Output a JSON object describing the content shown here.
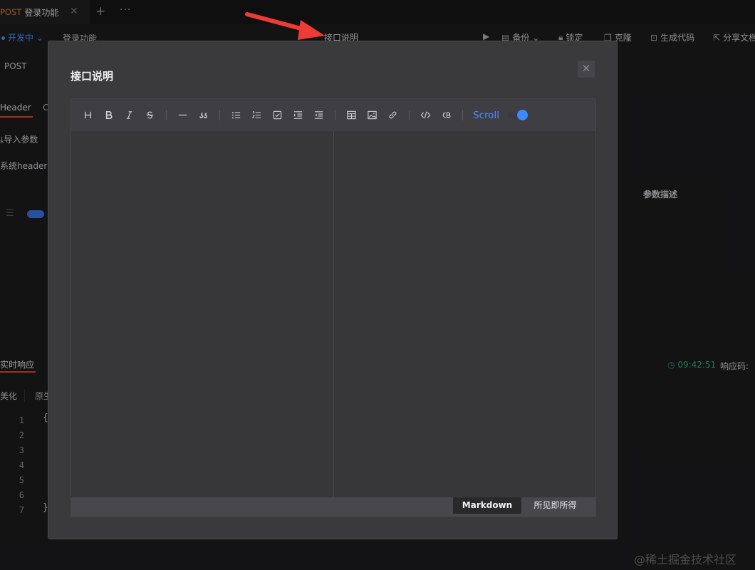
{
  "tab": {
    "method": "POST",
    "title": "登录功能",
    "close": "✕",
    "add": "+",
    "more": "···"
  },
  "subbar": {
    "env": "开发中",
    "crumb": "登录功能",
    "doc_link": "接口说明",
    "tools": [
      {
        "icon": "play-icon",
        "glyph": "▶",
        "label": ""
      },
      {
        "icon": "backup-icon",
        "glyph": "▤",
        "label": "备份"
      },
      {
        "icon": "lock-icon",
        "glyph": "🔒︎",
        "label": "锁定"
      },
      {
        "icon": "clone-icon",
        "glyph": "❐",
        "label": "克隆"
      },
      {
        "icon": "code-icon",
        "glyph": "⊡",
        "label": "生成代码"
      },
      {
        "icon": "share-icon",
        "glyph": "⇱",
        "label": "分享文档"
      }
    ]
  },
  "request": {
    "method": "POST",
    "tab_header": "Header",
    "tab_c": "C",
    "import_label": "导入参数",
    "sys_header": "系统header",
    "param_desc": "参数描述"
  },
  "response": {
    "tab": "实时响应",
    "time": "09:42:51",
    "code_label": "响应码:",
    "beautify": "美化",
    "raw": "原生",
    "line_numbers": [
      "1",
      "2",
      "3",
      "4",
      "5",
      "6",
      "7"
    ],
    "open_brace": "{",
    "close_brace": "}"
  },
  "modal": {
    "title": "接口说明",
    "close": "✕",
    "scroll_label": "Scroll",
    "scroll_enabled": true,
    "toolbar_groups": [
      [
        "heading-icon",
        "bold-icon",
        "italic-icon",
        "strikethrough-icon"
      ],
      [
        "hr-icon",
        "quote-icon"
      ],
      [
        "unordered-list-icon",
        "ordered-list-icon",
        "task-list-icon",
        "indent-icon",
        "outdent-icon"
      ],
      [
        "table-icon",
        "image-icon",
        "link-icon"
      ],
      [
        "code-icon",
        "code-block-icon"
      ]
    ],
    "mode_markdown": "Markdown",
    "mode_wysiwyg": "所见即所得",
    "active_mode": "Markdown"
  },
  "watermark": "@稀土掘金技术社区",
  "colors": {
    "accent_blue": "#3d88ff",
    "method_orange": "#d97b28",
    "tab_underline": "#d5472f",
    "time_green": "#2fa86a",
    "arrow_red": "#ee3b36"
  }
}
